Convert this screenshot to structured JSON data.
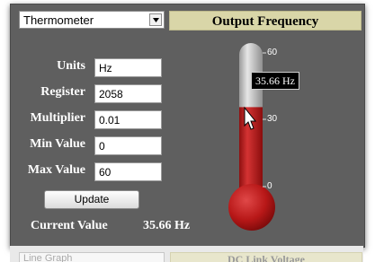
{
  "widget": {
    "type_select": "Thermometer",
    "title": "Output Frequency"
  },
  "form": {
    "units_label": "Units",
    "units_value": "Hz",
    "register_label": "Register",
    "register_value": "2058",
    "multiplier_label": "Multiplier",
    "multiplier_value": "0.01",
    "min_label": "Min Value",
    "min_value": "0",
    "max_label": "Max Value",
    "max_value": "60",
    "update_label": "Update"
  },
  "current": {
    "label": "Current Value",
    "value": "35.66 Hz"
  },
  "gauge": {
    "min": 0,
    "max": 60,
    "reading": 35.66,
    "tick_labels": [
      "60",
      "30",
      "0"
    ],
    "tooltip": "35.66 Hz",
    "fill_color": "#c01d1d",
    "empty_color": "#c4c4c4"
  },
  "next_widget": {
    "type_select": "Line Graph",
    "title": "DC Link Voltage"
  }
}
